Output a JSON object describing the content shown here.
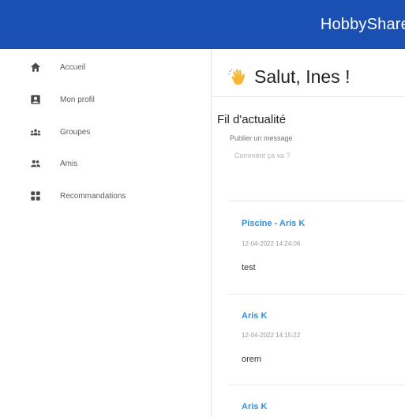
{
  "header": {
    "app_title": "HobbyShare"
  },
  "sidebar": {
    "items": [
      {
        "label": "Accueil",
        "icon": "home-icon"
      },
      {
        "label": "Mon profil",
        "icon": "profile-icon"
      },
      {
        "label": "Groupes",
        "icon": "groups-icon"
      },
      {
        "label": "Amis",
        "icon": "friends-icon"
      },
      {
        "label": "Recommandations",
        "icon": "recommendations-icon"
      }
    ]
  },
  "main": {
    "greeting": "Salut, Ines !",
    "greeting_icon": "waving-hand-icon",
    "feed_title": "Fil d'actualité",
    "post_input": {
      "value": "",
      "placeholder": "Publier un message",
      "hint": "Comment ça va ?"
    },
    "posts": [
      {
        "author": "Piscine - Aris K",
        "date": "12-04-2022 14:24:06",
        "body": "test"
      },
      {
        "author": "Aris K",
        "date": "12-04-2022 14:15:22",
        "body": "orem"
      },
      {
        "author": "Aris K",
        "date": "",
        "body": ""
      }
    ]
  },
  "colors": {
    "header_bg": "#1b50b3",
    "link": "#2f8fe0",
    "sidebar_text": "#5c5c5c"
  }
}
